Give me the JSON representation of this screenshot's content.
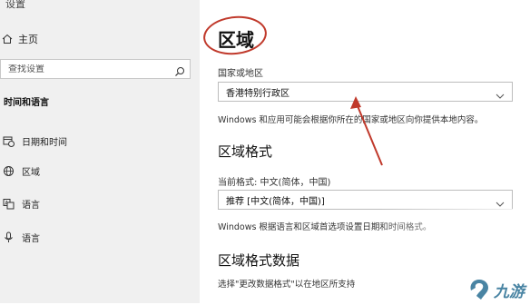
{
  "sidebar": {
    "top_label": "设置",
    "home": {
      "label": "主页",
      "icon": "home-icon"
    },
    "search": {
      "placeholder": "查找设置",
      "icon": "search-icon"
    },
    "section": "时间和语言",
    "items": [
      {
        "label": "日期和时间",
        "icon": "calendar-clock-icon"
      },
      {
        "label": "区域",
        "icon": "globe-icon"
      },
      {
        "label": "语言",
        "icon": "language-icon"
      },
      {
        "label": "语言",
        "icon": "microphone-icon"
      }
    ]
  },
  "main": {
    "title": "区域",
    "country_label": "国家或地区",
    "country_value": "香港特别行政区",
    "country_desc": "Windows 和应用可能会根据你所在的国家或地区向你提供本地内容。",
    "format_heading": "区域格式",
    "current_format_label": "当前格式: 中文(简体，中国)",
    "format_value": "推荐 [中文(简体，中国)]",
    "format_desc": "Windows 根据语言和区域首选项设置日期和时间格式。",
    "data_heading": "区域格式数据",
    "data_desc": "选择\"更改数据格式\"以在地区所支持"
  },
  "annotation": {
    "circle_color": "#c0392b",
    "arrow_color": "#c0392b"
  },
  "watermark": {
    "text": "九游",
    "icon": "jiuyou-logo"
  }
}
